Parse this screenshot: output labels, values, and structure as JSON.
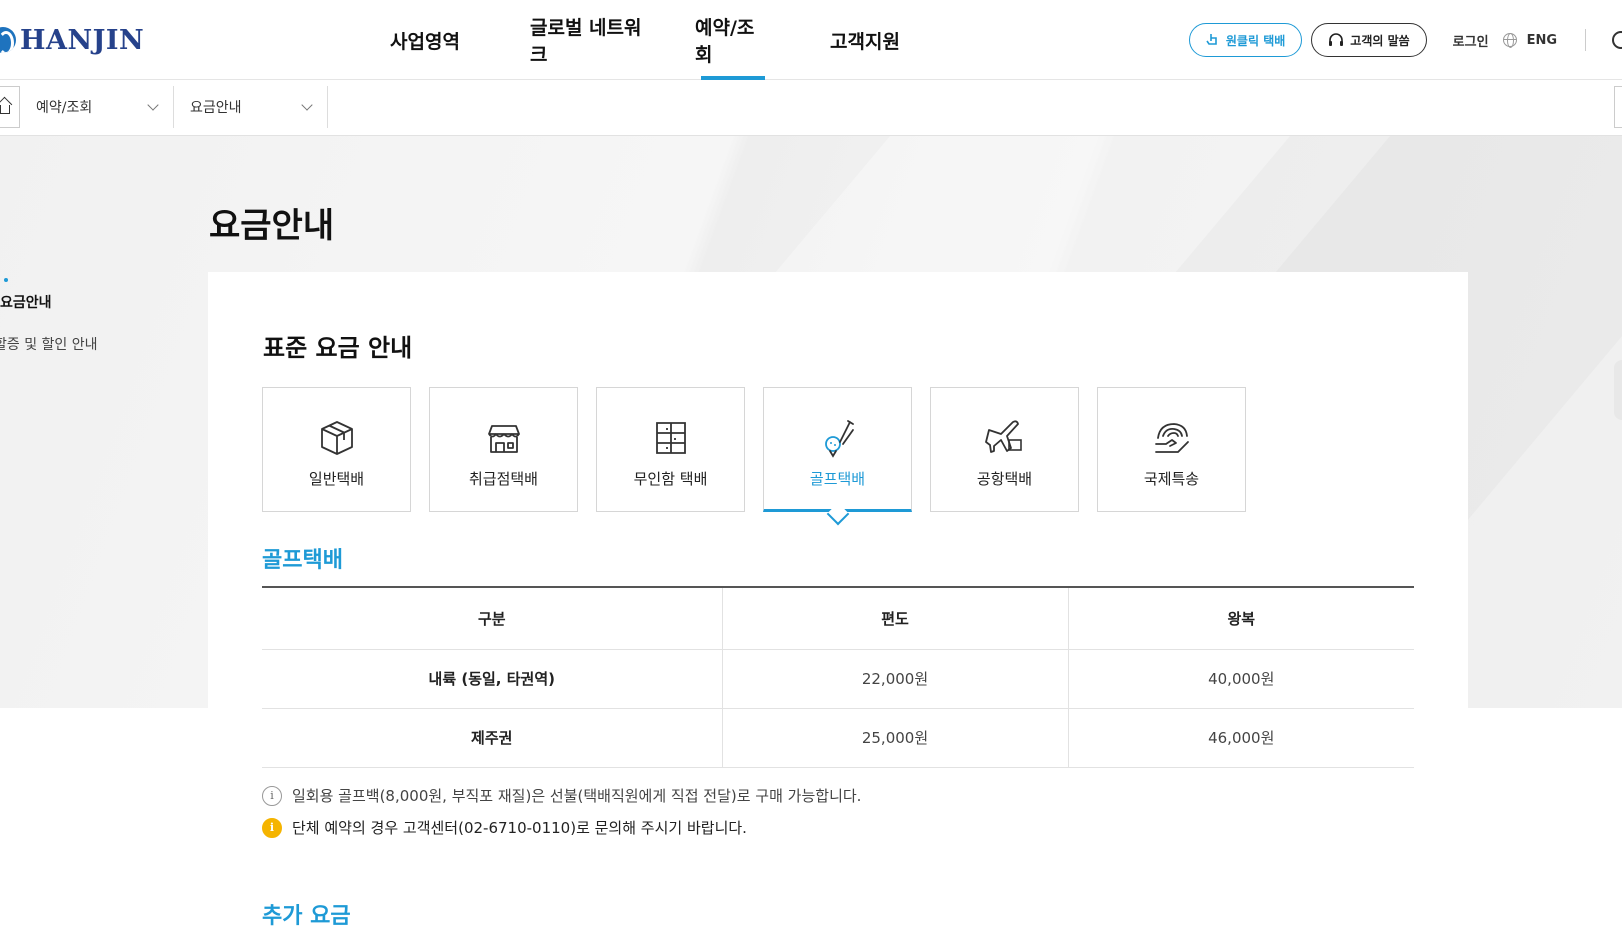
{
  "header": {
    "logo_text": "HANJIN",
    "nav": [
      "사업영역",
      "글로벌 네트워크",
      "예약/조회",
      "고객지원"
    ],
    "active_nav_index": 2,
    "one_click_label": "원클릭 택배",
    "voice_label": "고객의 말씀",
    "login_label": "로그인",
    "lang_label": "ENG"
  },
  "breadcrumb": {
    "items": [
      "예약/조회",
      "요금안내"
    ]
  },
  "page": {
    "title": "요금안내"
  },
  "lnb": {
    "items": [
      "요금안내",
      "할증 및 할인 안내"
    ],
    "active_index": 0
  },
  "main": {
    "section_title": "표준 요금 안내",
    "tabs": [
      {
        "label": "일반택배",
        "icon": "box-icon"
      },
      {
        "label": "취급점택배",
        "icon": "store-icon"
      },
      {
        "label": "무인함 택배",
        "icon": "locker-icon"
      },
      {
        "label": "골프택배",
        "icon": "golf-icon"
      },
      {
        "label": "공항택배",
        "icon": "airplane-icon"
      },
      {
        "label": "국제특송",
        "icon": "globe-hand-icon"
      }
    ],
    "active_tab_index": 3,
    "golf_title": "골프택배",
    "table": {
      "headers": [
        "구분",
        "편도",
        "왕복"
      ],
      "rows": [
        [
          "내륙 (동일, 타권역)",
          "22,000원",
          "40,000원"
        ],
        [
          "제주권",
          "25,000원",
          "46,000원"
        ]
      ]
    },
    "notes": [
      "일회용 골프백(8,000원, 부직포 재질)은 선불(택배직원에게 직접 전달)로 구매 가능합니다.",
      "단체 예약의 경우 고객센터(02-6710-0110)로 문의해 주시기 바랍니다."
    ],
    "extra_title": "추가 요금"
  },
  "colors": {
    "accent": "#1e9ad6",
    "brand": "#26428b",
    "warning": "#f5b400"
  }
}
